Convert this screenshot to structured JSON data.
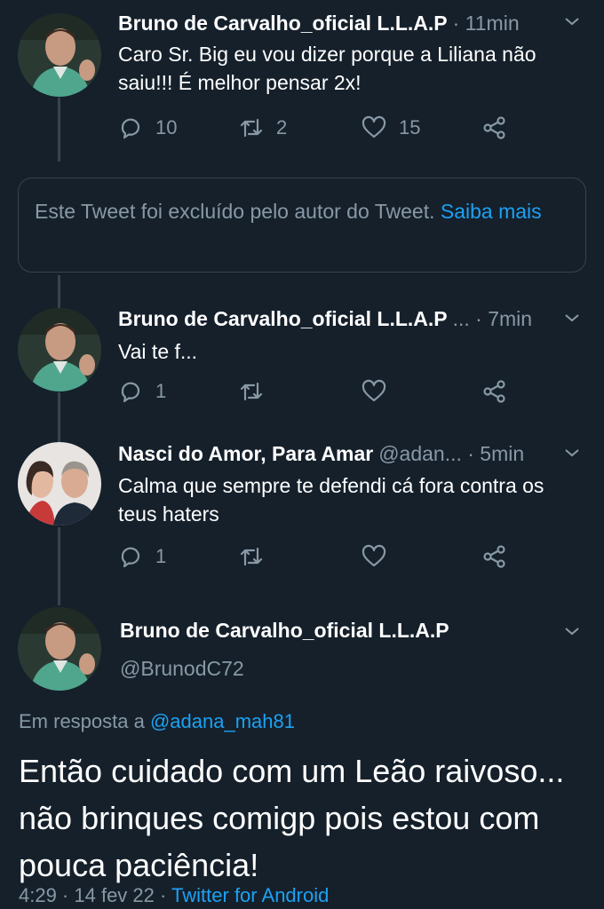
{
  "tweets": [
    {
      "name": "Bruno de Carvalho_oficial L.L.A.P",
      "meta": "· 11min",
      "text": "Caro Sr. Big eu vou dizer porque a Liliana não saiu!!! É melhor pensar 2x!",
      "replies": "10",
      "retweets": "2",
      "likes": "15"
    },
    {
      "name": "Bruno de Carvalho_oficial L.L.A.P",
      "meta": "... · 7min",
      "text": "Vai te f...",
      "replies": "1",
      "retweets": "",
      "likes": ""
    },
    {
      "name": "Nasci do Amor, Para Amar",
      "meta": "@adan... · 5min",
      "text": "Calma que sempre te defendi cá fora contra os teus haters",
      "replies": "1",
      "retweets": "",
      "likes": ""
    }
  ],
  "deleted_notice": {
    "text": "Este Tweet foi excluído pelo autor do Tweet.",
    "link": "Saiba mais"
  },
  "main_tweet": {
    "name": "Bruno de Carvalho_oficial L.L.A.P",
    "handle": "@BrunodC72",
    "reply_prefix": "Em resposta a",
    "reply_handle": "@adana_mah81",
    "text": "Então cuidado com um Leão raivoso... não brinques comigp pois estou com pouca paciência!",
    "time": "4:29 · 14 fev 22 ·",
    "source": "Twitter for Android"
  },
  "colors": {
    "background": "#15202b",
    "secondary_text": "#8899a6",
    "link": "#1da1f2",
    "border": "#38444d"
  },
  "icons": [
    "reply-icon",
    "retweet-icon",
    "like-icon",
    "share-icon",
    "chevron-down-icon"
  ]
}
